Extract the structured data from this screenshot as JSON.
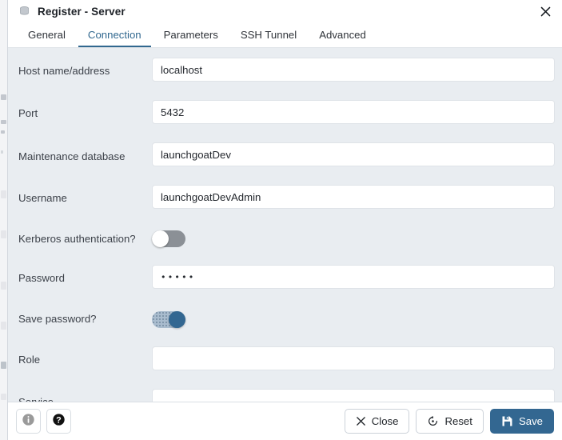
{
  "window": {
    "title": "Register - Server",
    "icon": "server-stack-icon",
    "close_icon": "close-icon"
  },
  "tabs": [
    {
      "label": "General",
      "name": "tab-general",
      "active": false
    },
    {
      "label": "Connection",
      "name": "tab-connection",
      "active": true
    },
    {
      "label": "Parameters",
      "name": "tab-parameters",
      "active": false
    },
    {
      "label": "SSH Tunnel",
      "name": "tab-ssh-tunnel",
      "active": false
    },
    {
      "label": "Advanced",
      "name": "tab-advanced",
      "active": false
    }
  ],
  "form": {
    "host": {
      "label": "Host name/address",
      "value": "localhost",
      "placeholder": ""
    },
    "port": {
      "label": "Port",
      "value": "5432",
      "placeholder": ""
    },
    "maintenance_db": {
      "label": "Maintenance database",
      "value": "launchgoatDev",
      "placeholder": ""
    },
    "username": {
      "label": "Username",
      "value": "launchgoatDevAdmin",
      "placeholder": ""
    },
    "kerberos": {
      "label": "Kerberos authentication?",
      "state": "off"
    },
    "password": {
      "label": "Password",
      "value": "•••••",
      "placeholder": ""
    },
    "save_password": {
      "label": "Save password?",
      "state": "on"
    },
    "role": {
      "label": "Role",
      "value": "",
      "placeholder": ""
    },
    "service": {
      "label": "Service",
      "value": "",
      "placeholder": ""
    }
  },
  "footer": {
    "info_icon": "info-icon",
    "help_icon": "help-icon",
    "close": {
      "label": "Close",
      "icon": "x-icon"
    },
    "reset": {
      "label": "Reset",
      "icon": "reset-icon"
    },
    "save": {
      "label": "Save",
      "icon": "save-disk-icon"
    }
  },
  "colors": {
    "accent": "#336791",
    "active_tab": "#31688f",
    "form_background": "#e9edf1",
    "toggle_off_track": "#8b9096",
    "toggle_on_knob": "#336791"
  }
}
